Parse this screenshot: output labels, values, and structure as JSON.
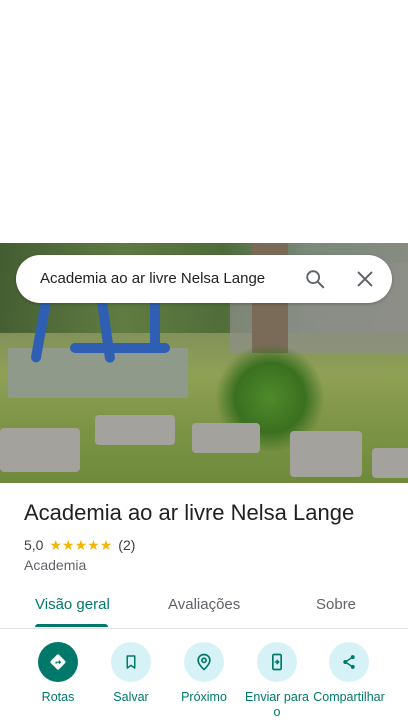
{
  "search": {
    "query": "Academia ao ar livre Nelsa Lange"
  },
  "place": {
    "title": "Academia ao ar livre Nelsa Lange",
    "rating": "5,0",
    "stars": 5,
    "reviews_count": "(2)",
    "category": "Academia"
  },
  "tabs": [
    {
      "label": "Visão geral",
      "active": true
    },
    {
      "label": "Avaliações",
      "active": false
    },
    {
      "label": "Sobre",
      "active": false
    }
  ],
  "actions": [
    {
      "label": "Rotas",
      "icon": "directions-icon"
    },
    {
      "label": "Salvar",
      "icon": "bookmark-icon"
    },
    {
      "label": "Próximo",
      "icon": "nearby-icon"
    },
    {
      "label": "Enviar para o",
      "icon": "send-to-phone-icon"
    },
    {
      "label": "Compartilhar",
      "icon": "share-icon"
    }
  ],
  "colors": {
    "accent": "#00796b",
    "chip_bg": "#d7f2f6",
    "star": "#f4b400"
  }
}
